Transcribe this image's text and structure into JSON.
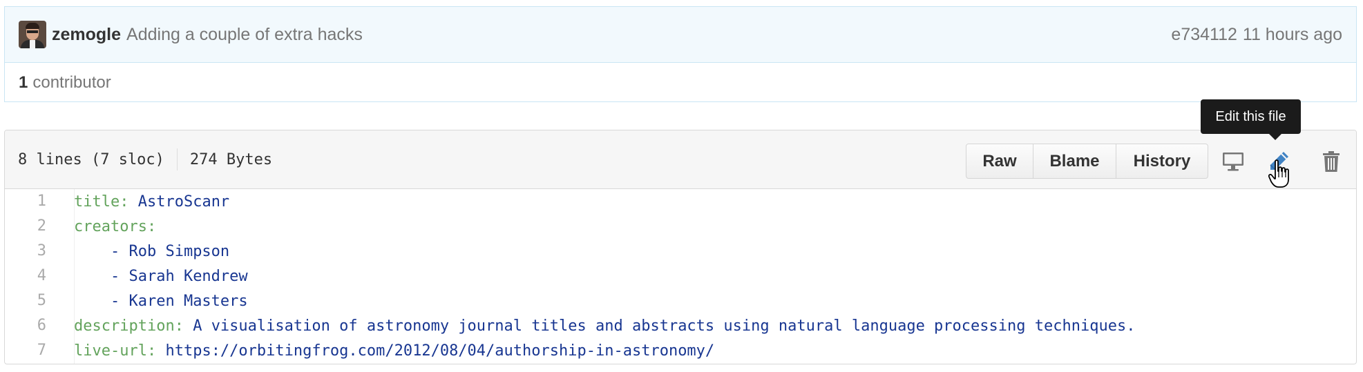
{
  "commit": {
    "author": "zemogle",
    "message": "Adding a couple of extra hacks",
    "sha": "e734112",
    "time": "11 hours ago"
  },
  "contributors": {
    "count": "1",
    "label": "contributor"
  },
  "file": {
    "lines_info": "8 lines (7 sloc)",
    "size": "274 Bytes",
    "buttons": {
      "raw": "Raw",
      "blame": "Blame",
      "history": "History"
    },
    "icons": [
      "desktop-icon",
      "pencil-icon",
      "trash-icon"
    ],
    "tooltip": "Edit this file"
  },
  "code_lines": [
    {
      "num": "1",
      "indent": "",
      "key": "title:",
      "value": " AstroScanr"
    },
    {
      "num": "2",
      "indent": "",
      "key": "creators:",
      "value": ""
    },
    {
      "num": "3",
      "indent": "    ",
      "key": "",
      "value": "- Rob Simpson"
    },
    {
      "num": "4",
      "indent": "    ",
      "key": "",
      "value": "- Sarah Kendrew"
    },
    {
      "num": "5",
      "indent": "    ",
      "key": "",
      "value": "- Karen Masters"
    },
    {
      "num": "6",
      "indent": "",
      "key": "description:",
      "value": " A visualisation of astronomy journal titles and abstracts using natural language processing techniques."
    },
    {
      "num": "7",
      "indent": "",
      "key": "live-url:",
      "value": " https://orbitingfrog.com/2012/08/04/authorship-in-astronomy/"
    }
  ],
  "colors": {
    "key": "#63a35c",
    "value": "#183691",
    "edit_icon": "#4183c4",
    "commit_bar_bg": "#f2f9fd"
  }
}
